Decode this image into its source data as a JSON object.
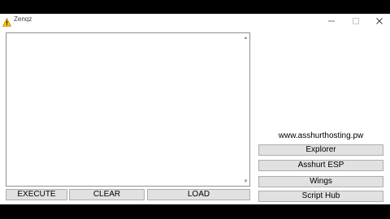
{
  "window": {
    "title": "Zenqz",
    "title_icon": "warning-icon",
    "controls": [
      "minimize-icon",
      "maximize-icon",
      "close-icon"
    ]
  },
  "editor": {
    "value": "",
    "scroll_up_icon": "chevron-up-icon",
    "scroll_down_icon": "chevron-down-icon"
  },
  "toolbar": {
    "execute_label": "EXECUTE",
    "clear_label": "CLEAR",
    "load_label": "LOAD"
  },
  "sidebar": {
    "site": "www.asshurthosting.pw",
    "items": [
      {
        "label": "Explorer"
      },
      {
        "label": "Asshurt ESP"
      },
      {
        "label": "Wings"
      },
      {
        "label": "Script Hub"
      }
    ]
  }
}
